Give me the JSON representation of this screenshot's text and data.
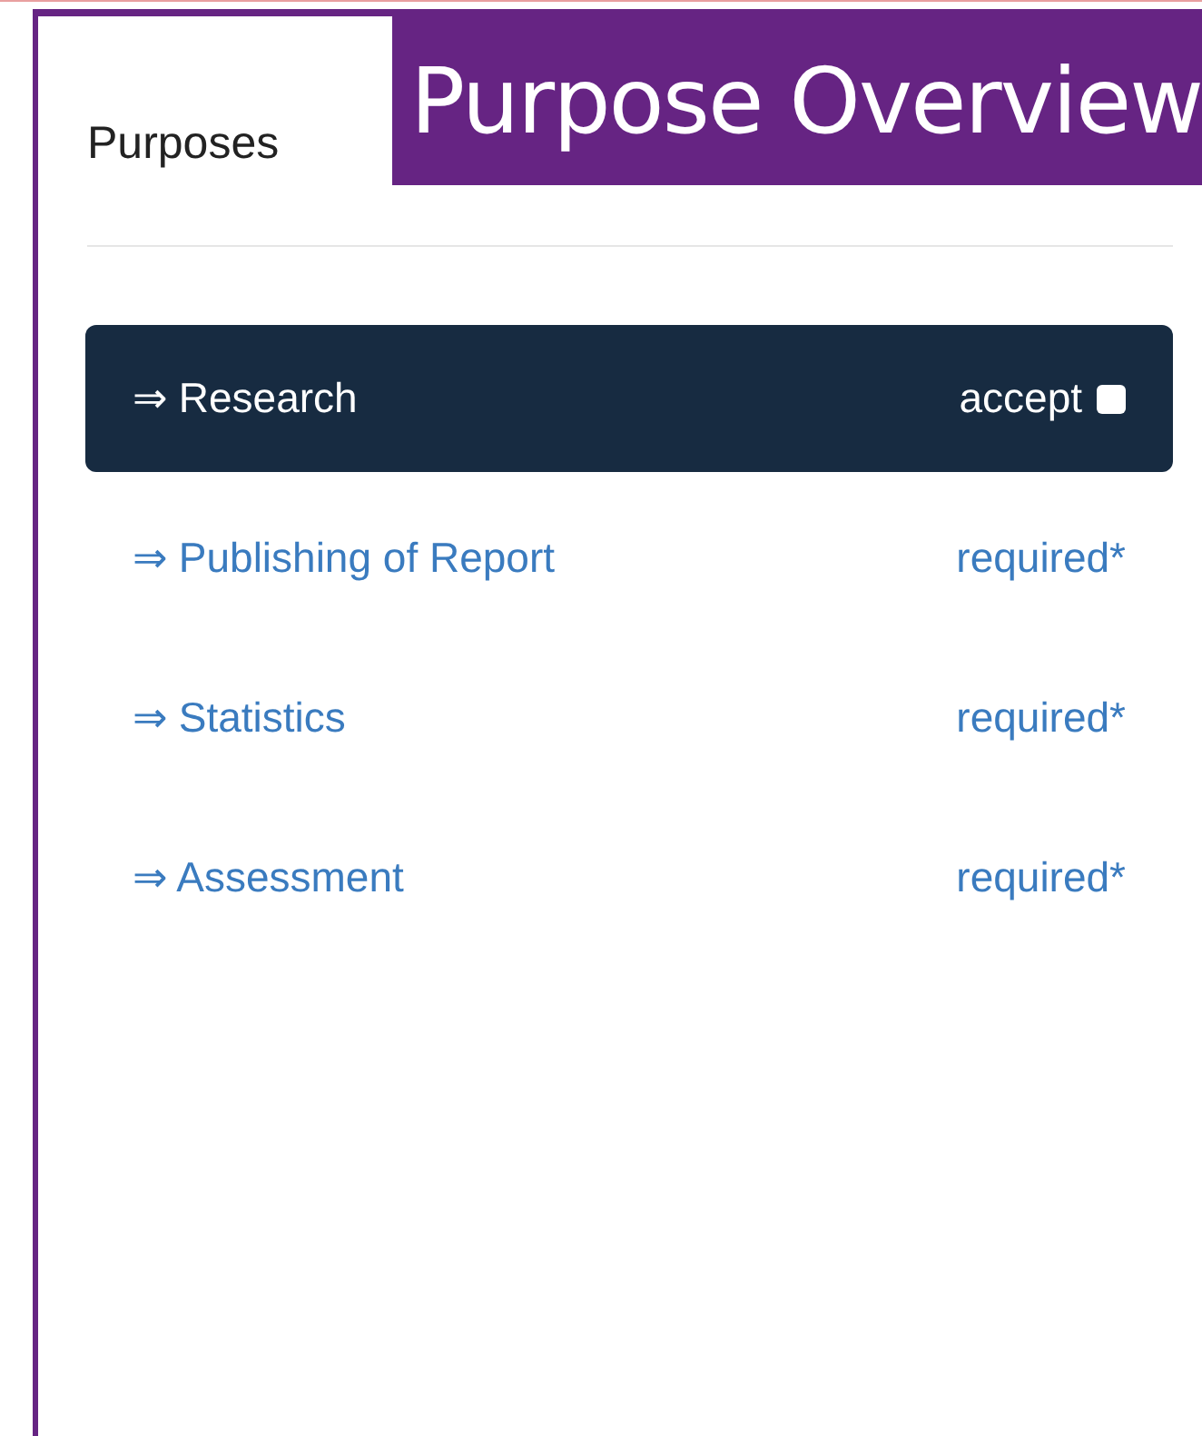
{
  "banner": {
    "title": "Purpose Overview"
  },
  "panel": {
    "title": "Purposes"
  },
  "purposes": [
    {
      "label": "⇒ Research",
      "selected": true,
      "kind": "consent",
      "status": "accept",
      "checked": false
    },
    {
      "label": "⇒ Publishing of Report",
      "selected": false,
      "kind": "required",
      "status": "required*"
    },
    {
      "label": "⇒ Statistics",
      "selected": false,
      "kind": "required",
      "status": "required*"
    },
    {
      "label": "⇒ Assessment",
      "selected": false,
      "kind": "required",
      "status": "required*"
    }
  ]
}
